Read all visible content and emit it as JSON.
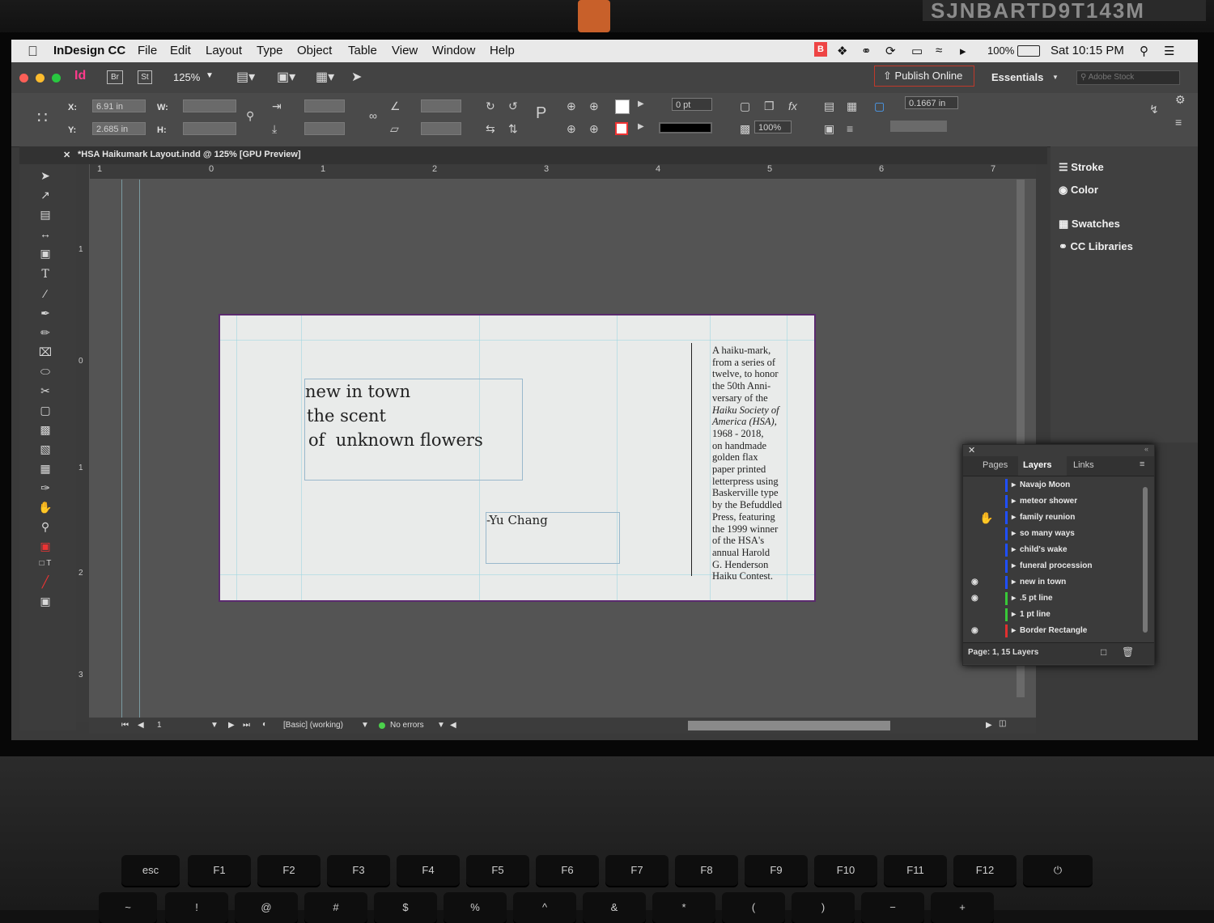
{
  "physical": {
    "sticker_text": "SJNBARTD9T143M"
  },
  "menubar": {
    "app_name": "InDesign CC",
    "menus": [
      "File",
      "Edit",
      "Layout",
      "Type",
      "Object",
      "Table",
      "View",
      "Window",
      "Help"
    ],
    "battery": "100%",
    "clock": "Sat 10:15 PM"
  },
  "appbar": {
    "br": "Br",
    "st": "St",
    "zoom": "125%",
    "publish_label": "Publish Online",
    "workspace": "Essentials",
    "search_placeholder": "Adobe Stock"
  },
  "control": {
    "x_label": "X:",
    "y_label": "Y:",
    "w_label": "W:",
    "h_label": "H:",
    "x_value": "6.91 in",
    "y_value": "2.685 in",
    "stroke_weight": "0 pt",
    "opacity": "100%",
    "offset": "0.1667 in"
  },
  "document": {
    "tab_title": "*HSA Haikumark Layout.indd @ 125% [GPU Preview]",
    "ruler_h": [
      "1",
      "0",
      "1",
      "2",
      "3",
      "4",
      "5",
      "6",
      "7"
    ],
    "ruler_v": [
      "1",
      "0",
      "1",
      "2",
      "3"
    ],
    "haiku_lines": [
      "new in town",
      "the scent",
      "of  unknown flowers"
    ],
    "author": "-Yu Chang",
    "colophon_lines": [
      "A haiku-mark,",
      "from a series of",
      "twelve, to honor",
      "the 50th Anni-",
      "versary of the",
      "Haiku Society of",
      "America (HSA),",
      "1968 - 2018,",
      "on handmade",
      "golden flax",
      "paper printed",
      "letterpress using",
      "Baskerville type",
      "by the Befuddled",
      "Press, featuring",
      "the 1999 winner",
      "of the HSA's",
      "annual Harold",
      "G. Henderson",
      "Haiku Contest."
    ]
  },
  "statusbar": {
    "page": "1",
    "preflight_profile": "[Basic] (working)",
    "errors": "No errors"
  },
  "dock": {
    "items": [
      "Stroke",
      "Color",
      "Swatches",
      "CC Libraries"
    ]
  },
  "layers_panel": {
    "tabs": [
      "Pages",
      "Layers",
      "Links"
    ],
    "active_tab": "Layers",
    "layers": [
      {
        "name": "Navajo Moon",
        "color": "#1f4fff",
        "visible": false
      },
      {
        "name": "meteor shower",
        "color": "#1f4fff",
        "visible": false
      },
      {
        "name": "family reunion",
        "color": "#1f4fff",
        "visible": false
      },
      {
        "name": "so many ways",
        "color": "#1f4fff",
        "visible": false
      },
      {
        "name": "child's wake",
        "color": "#1f4fff",
        "visible": false
      },
      {
        "name": "funeral procession",
        "color": "#1f4fff",
        "visible": false
      },
      {
        "name": "new in town",
        "color": "#1f4fff",
        "visible": true
      },
      {
        "name": ".5 pt line",
        "color": "#38c838",
        "visible": true
      },
      {
        "name": "1 pt line",
        "color": "#38c838",
        "visible": false
      },
      {
        "name": "Border Rectangle",
        "color": "#e03030",
        "visible": true
      }
    ],
    "footer": "Page: 1, 15 Layers"
  },
  "keyboard": {
    "fn_row": [
      "esc",
      "F1",
      "F2",
      "F3",
      "F4",
      "F5",
      "F6",
      "F7",
      "F8",
      "F9",
      "F10",
      "F11",
      "F12"
    ],
    "num_row": [
      "~",
      "!",
      "@",
      "#",
      "$",
      "%",
      "^",
      "&",
      "*",
      "(",
      ")",
      "−",
      "+"
    ]
  },
  "colors": {
    "page_border": "#5a2a6e",
    "guide": "#9bd6e0",
    "publish_border": "#c0392b"
  }
}
